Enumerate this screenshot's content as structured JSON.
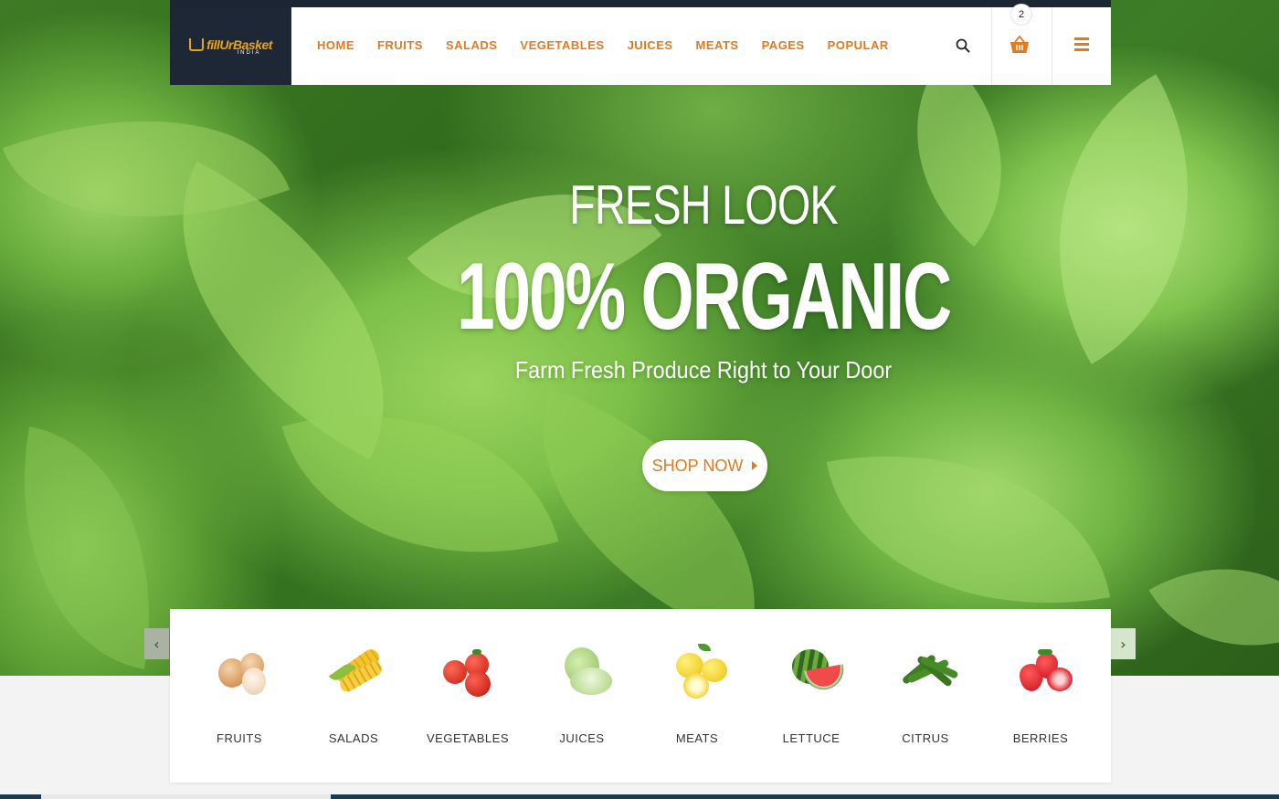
{
  "brand": {
    "name": "fillUrBasket",
    "sub": "INDIA"
  },
  "nav": {
    "items": [
      "HOME",
      "FRUITS",
      "SALADS",
      "VEGETABLES",
      "JUICES",
      "MEATS",
      "PAGES",
      "POPULAR"
    ]
  },
  "cart": {
    "count": "2"
  },
  "hero": {
    "line1": "FRESH LOOK",
    "line2": "100% ORGANIC",
    "line3": "Farm Fresh Produce Right to Your Door",
    "cta": "SHOP NOW"
  },
  "categories": [
    {
      "label": "FRUITS",
      "icon": "onion-icon"
    },
    {
      "label": "SALADS",
      "icon": "corn-icon"
    },
    {
      "label": "VEGETABLES",
      "icon": "tomato-icon"
    },
    {
      "label": "JUICES",
      "icon": "cabbage-icon"
    },
    {
      "label": "MEATS",
      "icon": "lemon-icon"
    },
    {
      "label": "LETTUCE",
      "icon": "watermelon-icon"
    },
    {
      "label": "CITRUS",
      "icon": "okra-icon"
    },
    {
      "label": "BERRIES",
      "icon": "strawberry-icon"
    }
  ],
  "carousel": {
    "prev": "‹",
    "next": "›"
  },
  "colors": {
    "accent": "#e27a1f",
    "dark": "#1e2736"
  }
}
